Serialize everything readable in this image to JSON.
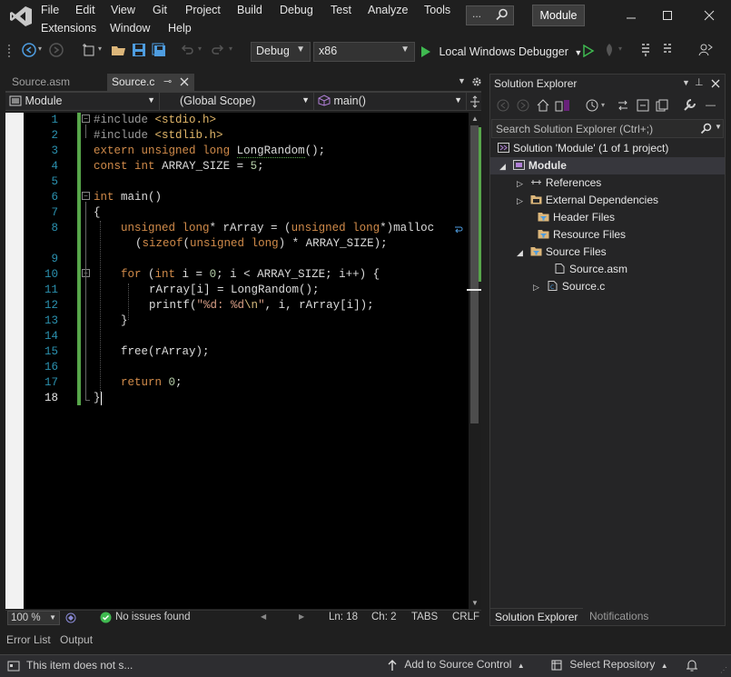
{
  "menu": {
    "row1": [
      "File",
      "Edit",
      "View",
      "Git",
      "Project",
      "Build",
      "Debug",
      "Test",
      "Analyze",
      "Tools"
    ],
    "row2": [
      "Extensions",
      "Window",
      "Help"
    ],
    "search_placeholder": "...",
    "solution_name": "Module"
  },
  "toolbar": {
    "config": "Debug",
    "platform": "x86",
    "debugger": "Local Windows Debugger"
  },
  "doc_tabs": [
    {
      "label": "Source.asm",
      "active": false
    },
    {
      "label": "Source.c",
      "active": true
    }
  ],
  "navbar": {
    "project": "Module",
    "scope": "(Global Scope)",
    "member": "main()"
  },
  "code": {
    "lines": [
      "1",
      "2",
      "3",
      "4",
      "5",
      "6",
      "7",
      "8",
      "",
      "9",
      "10",
      "11",
      "12",
      "13",
      "14",
      "15",
      "16",
      "17",
      "18"
    ],
    "current_line": "18",
    "l1_pp": "#include",
    "l1_inc": "<stdio.h>",
    "l2_pp": "#include",
    "l2_inc": "<stdlib.h>",
    "l3_kw1": "extern",
    "l3_kw2": "unsigned",
    "l3_kw3": "long",
    "l3_fn": "LongRandom",
    "l3_rest": "();",
    "l4_kw1": "const",
    "l4_kw2": "int",
    "l4_rest": "ARRAY_SIZE = ",
    "l4_num": "5",
    "l4_end": ";",
    "l6_kw": "int",
    "l6_fn": "main",
    "l6_rest": "()",
    "l7": "{",
    "l8_kw1": "unsigned",
    "l8_kw2": "long",
    "l8_rest1": "* rArray = (",
    "l8_kw3": "unsigned",
    "l8_kw4": "long",
    "l8_rest2": "*)",
    "l8_fn": "malloc",
    "l8b_rest1": "(",
    "l8b_kw1": "sizeof",
    "l8b_rest2": "(",
    "l8b_kw2": "unsigned",
    "l8b_kw3": "long",
    "l8b_rest3": ") * ARRAY_SIZE);",
    "l10_kw1": "for",
    "l10_rest1": " (",
    "l10_kw2": "int",
    "l10_rest2": " i = ",
    "l10_num1": "0",
    "l10_rest3": "; i < ARRAY_SIZE; i++) {",
    "l11_rest1": "rArray[i] = ",
    "l11_fn": "LongRandom",
    "l11_rest2": "();",
    "l12_fn": "printf",
    "l12_rest1": "(",
    "l12_str1": "\"%d: %d",
    "l12_esc": "\\n",
    "l12_str2": "\"",
    "l12_rest2": ", i, rArray[i]);",
    "l13": "}",
    "l15_fn": "free",
    "l15_rest": "(rArray);",
    "l17_kw": "return",
    "l17_num": "0",
    "l17_end": ";",
    "l18": "}"
  },
  "editor_status": {
    "zoom": "100 %",
    "issues": "No issues found",
    "ln": "Ln: 18",
    "ch": "Ch: 2",
    "tabs": "TABS",
    "eol": "CRLF"
  },
  "solution_explorer": {
    "title": "Solution Explorer",
    "search_placeholder": "Search Solution Explorer (Ctrl+;)",
    "solution": "Solution 'Module'  (1 of 1 project)",
    "project": "Module",
    "references": "References",
    "external_deps": "External Dependencies",
    "header_files": "Header Files",
    "resource_files": "Resource Files",
    "source_files": "Source Files",
    "source_asm": "Source.asm",
    "source_c": "Source.c",
    "tab_se": "Solution Explorer",
    "tab_notif": "Notifications"
  },
  "tool_tabs": [
    "Error List",
    "Output"
  ],
  "statusbar": {
    "message": "This item does not s...",
    "source_control": "Add to Source Control",
    "repository": "Select Repository"
  }
}
